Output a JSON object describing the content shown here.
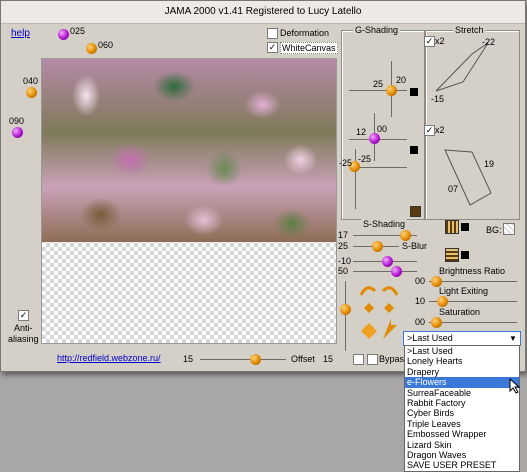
{
  "window": {
    "title": "JAMA 2000    v1.41   Registered to Lucy Latello"
  },
  "links": {
    "help": "help",
    "url": "http://redfield.webzone.ru/"
  },
  "left_knobs": {
    "k025": "025",
    "k060": "060",
    "k040": "040",
    "k090": "090"
  },
  "checkboxes": {
    "deformation": "Deformation",
    "whitecanvas": "WhiteCanvas",
    "antialiasing": "Anti-\naliasing",
    "bypass": "Bypass",
    "x2_top": "x2",
    "x2_bottom": "x2"
  },
  "gshading": {
    "title": "G-Shading",
    "v1a": "25",
    "v1b": "20",
    "v2a": "12",
    "v2b": "00",
    "v3a": "-25",
    "v3b": "-25"
  },
  "stretch": {
    "title": "Stretch",
    "a": "-22",
    "b": "-15",
    "c": "19",
    "d": "07"
  },
  "sshading": {
    "title": "S-Shading",
    "v17": "17",
    "v25": "25",
    "sblur": "S-Blur",
    "vm10": "-10",
    "v50": "50",
    "bg": "BG:"
  },
  "right_sliders": {
    "brightness_value": "00",
    "brightness_label": "Brightness Ratio",
    "light_label": "Light Exiting",
    "light_value": "10",
    "saturation_label": "Saturation",
    "saturation_value": "00"
  },
  "offset": {
    "left_value": "15",
    "label": "Offset",
    "right_value": "15"
  },
  "preset": {
    "selected": ">Last Used",
    "items": [
      ">Last Used",
      "Lonely Hearts",
      "Drapery",
      "e-Flowers",
      "SurreaFaceable",
      "Rabbit Factory",
      "Cyber Birds",
      "Triple Leaves",
      "Embossed Wrapper",
      "Lizard Skin",
      "Dragon Waves",
      "SAVE USER PRESET"
    ],
    "highlighted_index": 3
  },
  "icons": {
    "checkmark": "✓",
    "dropdown": "▼"
  }
}
